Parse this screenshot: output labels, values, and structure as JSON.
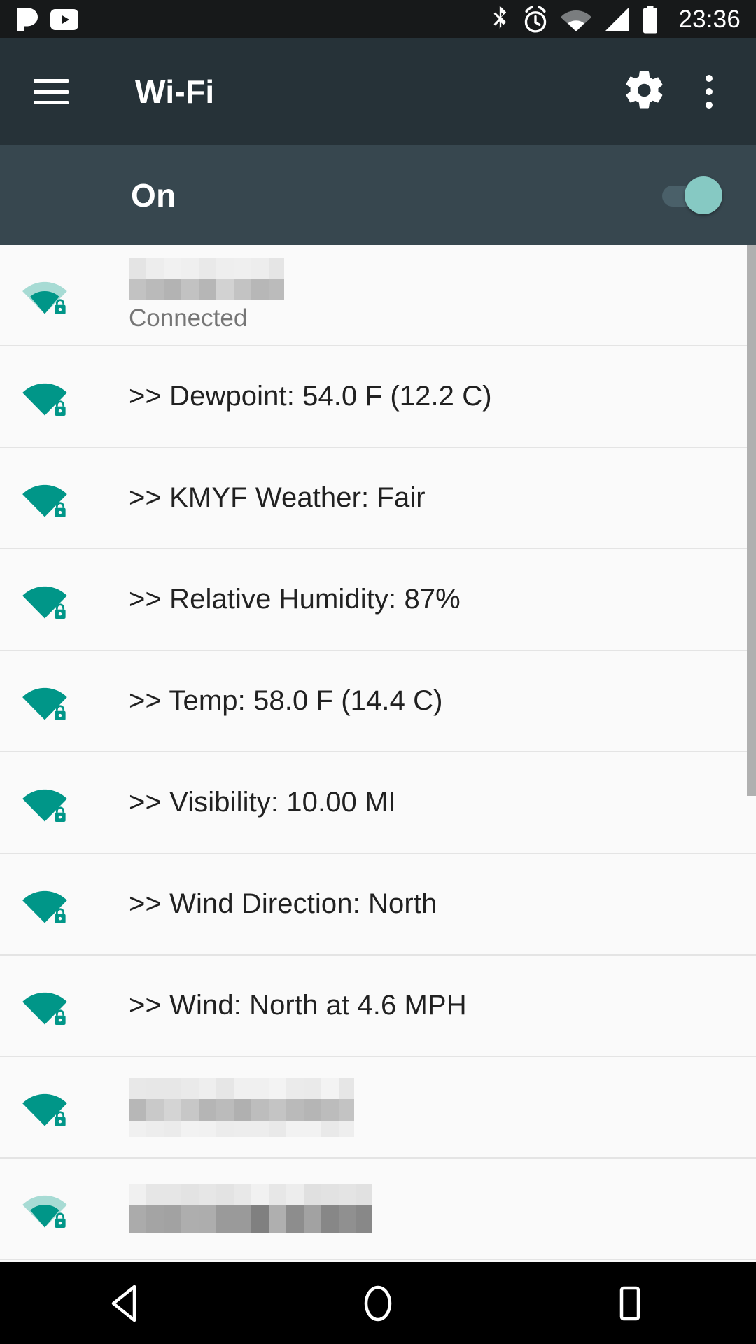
{
  "status_bar": {
    "time": "23:36",
    "left_icons": [
      {
        "name": "pandora-icon",
        "label": "Pandora"
      },
      {
        "name": "youtube-icon",
        "label": "YouTube"
      }
    ],
    "right_icons": [
      {
        "name": "bluetooth-icon",
        "label": "Bluetooth"
      },
      {
        "name": "alarm-icon",
        "label": "Alarm set"
      },
      {
        "name": "wifi-status-icon",
        "label": "Wi-Fi signal"
      },
      {
        "name": "cellular-signal-icon",
        "label": "Cellular signal"
      },
      {
        "name": "battery-icon",
        "label": "Battery full"
      }
    ],
    "background": "#17191A"
  },
  "app_bar": {
    "title": "Wi-Fi",
    "menu_icon": "hamburger-icon",
    "settings_icon": "gear-icon",
    "overflow_icon": "overflow-menu-icon",
    "background": "#263238"
  },
  "wifi_toggle": {
    "label": "On",
    "state": "on",
    "background": "#37474F",
    "thumb_color": "#86C9C3",
    "track_color": "#4A6069"
  },
  "colors": {
    "accent_teal": "#00897B",
    "icon_teal": "#009688",
    "icon_teal_light": "#A7DBD4",
    "list_background": "#FAFAFA",
    "divider": "#E4E4E4",
    "primary_text": "#212121",
    "secondary_text": "#757575",
    "scrollbar": "#B0B0B0",
    "nav_bar": "#000000"
  },
  "network_list": {
    "scrollbar_visible": true,
    "networks": [
      {
        "ssid": "",
        "ssid_redacted": true,
        "status": "Connected",
        "signal": "partial",
        "secured": true,
        "icon": "wifi-lock-icon"
      },
      {
        "ssid": ">> Dewpoint: 54.0 F (12.2 C)",
        "ssid_redacted": false,
        "status": "",
        "signal": "full",
        "secured": true,
        "icon": "wifi-lock-icon"
      },
      {
        "ssid": ">> KMYF Weather: Fair",
        "ssid_redacted": false,
        "status": "",
        "signal": "full",
        "secured": true,
        "icon": "wifi-lock-icon"
      },
      {
        "ssid": ">> Relative Humidity: 87%",
        "ssid_redacted": false,
        "status": "",
        "signal": "full",
        "secured": true,
        "icon": "wifi-lock-icon"
      },
      {
        "ssid": ">> Temp: 58.0 F (14.4 C)",
        "ssid_redacted": false,
        "status": "",
        "signal": "full",
        "secured": true,
        "icon": "wifi-lock-icon"
      },
      {
        "ssid": ">> Visibility: 10.00 MI",
        "ssid_redacted": false,
        "status": "",
        "signal": "full",
        "secured": true,
        "icon": "wifi-lock-icon"
      },
      {
        "ssid": ">> Wind Direction: North",
        "ssid_redacted": false,
        "status": "",
        "signal": "full",
        "secured": true,
        "icon": "wifi-lock-icon"
      },
      {
        "ssid": ">> Wind: North at 4.6 MPH",
        "ssid_redacted": false,
        "status": "",
        "signal": "full",
        "secured": true,
        "icon": "wifi-lock-icon"
      },
      {
        "ssid": "",
        "ssid_redacted": true,
        "status": "",
        "signal": "full",
        "secured": true,
        "icon": "wifi-lock-icon"
      },
      {
        "ssid": "",
        "ssid_redacted": true,
        "status": "",
        "signal": "partial",
        "secured": true,
        "icon": "wifi-lock-icon"
      }
    ]
  },
  "nav_bar": {
    "buttons": [
      {
        "name": "back-button",
        "label": "Back"
      },
      {
        "name": "home-button",
        "label": "Home"
      },
      {
        "name": "recents-button",
        "label": "Recents"
      }
    ]
  }
}
